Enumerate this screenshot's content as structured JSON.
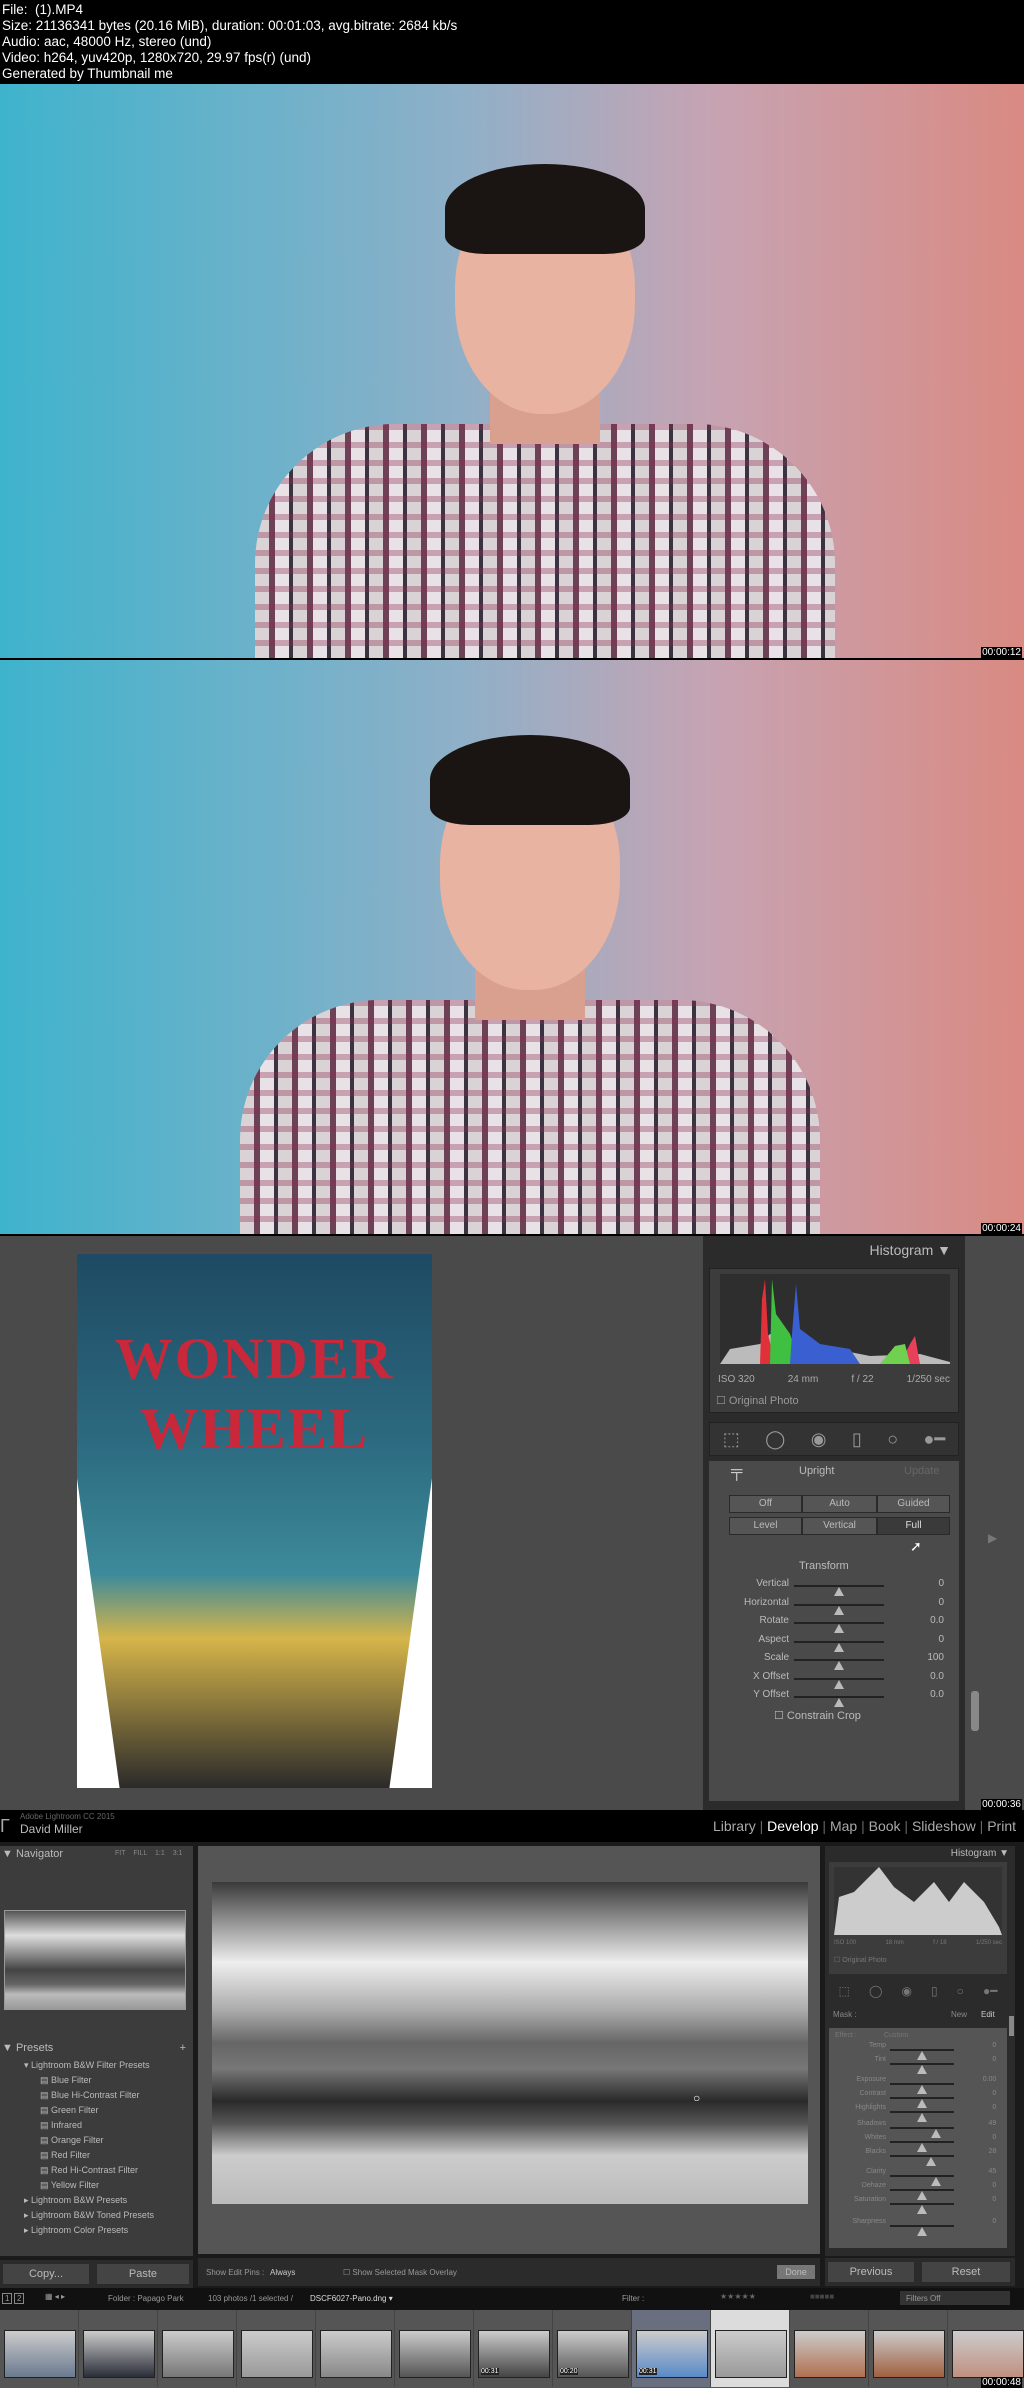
{
  "info_header": {
    "file": "File:  (1).MP4",
    "size": "Size: 21136341 bytes (20.16 MiB), duration: 00:01:03, avg.bitrate: 2684 kb/s",
    "audio": "Audio: aac, 48000 Hz, stereo (und)",
    "video": "Video: h264, yuv420p, 1280x720, 29.97 fps(r) (und)",
    "generated": "Generated by Thumbnail me"
  },
  "frames": [
    {
      "timestamp": "00:00:12"
    },
    {
      "timestamp": "00:00:24"
    },
    {
      "timestamp": "00:00:36"
    },
    {
      "timestamp": "00:00:48"
    }
  ],
  "frame3": {
    "photo_text": [
      "WONDER",
      "WHEEL"
    ],
    "histogram": {
      "title": "Histogram",
      "iso": "ISO 320",
      "focal": "24 mm",
      "aperture": "f / 22",
      "shutter": "1/250 sec",
      "original_photo": "Original Photo"
    },
    "upright": {
      "title": "Upright",
      "update": "Update",
      "buttons": [
        "Off",
        "Auto",
        "Guided",
        "Level",
        "Vertical",
        "Full"
      ],
      "selected": "Full"
    },
    "transform": {
      "title": "Transform",
      "sliders": [
        {
          "label": "Vertical",
          "value": "0",
          "pos": 0.5
        },
        {
          "label": "Horizontal",
          "value": "0",
          "pos": 0.5
        },
        {
          "label": "Rotate",
          "value": "0.0",
          "pos": 0.5
        },
        {
          "label": "Aspect",
          "value": "0",
          "pos": 0.5
        },
        {
          "label": "Scale",
          "value": "100",
          "pos": 0.5
        },
        {
          "label": "X Offset",
          "value": "0.0",
          "pos": 0.5
        },
        {
          "label": "Y Offset",
          "value": "0.0",
          "pos": 0.5
        }
      ],
      "constrain_crop": "Constrain Crop"
    }
  },
  "frame4": {
    "app_title": "Adobe Lightroom CC 2015",
    "user": "David Miller",
    "modules": [
      "Library",
      "Develop",
      "Map",
      "Book",
      "Slideshow",
      "Print"
    ],
    "active_module": "Develop",
    "navigator": {
      "title": "Navigator",
      "zoom": [
        "FIT",
        "FILL",
        "1:1",
        "3:1"
      ]
    },
    "presets": {
      "title": "Presets",
      "add": "+",
      "groups": [
        {
          "label": "Lightroom B&W Filter Presets",
          "expanded": true,
          "items": [
            "Blue Filter",
            "Blue Hi-Contrast Filter",
            "Green Filter",
            "Infrared",
            "Orange Filter",
            "Red Filter",
            "Red Hi-Contrast Filter",
            "Yellow Filter"
          ]
        },
        {
          "label": "Lightroom B&W Presets",
          "expanded": false
        },
        {
          "label": "Lightroom B&W Toned Presets",
          "expanded": false
        },
        {
          "label": "Lightroom Color Presets",
          "expanded": false
        }
      ]
    },
    "copy": "Copy...",
    "paste": "Paste",
    "toolbar": {
      "show_edit_pins": "Show Edit Pins :",
      "edit_pins_value": "Always",
      "show_mask_overlay": "Show Selected Mask Overlay",
      "done": "Done"
    },
    "histogram": {
      "title": "Histogram",
      "iso": "ISO 100",
      "focal": "18 mm",
      "aperture": "f / 18",
      "shutter": "1/250 sec",
      "original_photo": "Original Photo"
    },
    "mask": {
      "label": "Mask :",
      "new": "New",
      "edit": "Edit",
      "effect_label": "Effect :",
      "effect_value": "Custom"
    },
    "sliders": [
      {
        "label": "Temp",
        "value": "0",
        "pos": 0.5
      },
      {
        "label": "Tint",
        "value": "0",
        "pos": 0.5
      },
      {
        "label": "Exposure",
        "value": "0.00",
        "pos": 0.5
      },
      {
        "label": "Contrast",
        "value": "0",
        "pos": 0.5
      },
      {
        "label": "Highlights",
        "value": "0",
        "pos": 0.5
      },
      {
        "label": "Shadows",
        "value": "49",
        "pos": 0.72
      },
      {
        "label": "Whites",
        "value": "0",
        "pos": 0.5
      },
      {
        "label": "Blacks",
        "value": "28",
        "pos": 0.64
      },
      {
        "label": "Clarity",
        "value": "45",
        "pos": 0.72
      },
      {
        "label": "Dehaze",
        "value": "0",
        "pos": 0.5
      },
      {
        "label": "Saturation",
        "value": "0",
        "pos": 0.5
      },
      {
        "label": "Sharpness",
        "value": "0",
        "pos": 0.5
      }
    ],
    "previous": "Previous",
    "reset": "Reset",
    "filmstrip": {
      "pages": [
        "1",
        "2"
      ],
      "folder": "Folder : Papago Park",
      "selection": "103 photos /1 selected /",
      "filename": "DSCF6027-Pano.dng",
      "filter_label": "Filter :",
      "filters_off": "Filters Off",
      "durations": [
        "00:31",
        "00:20",
        "00:31"
      ]
    }
  }
}
